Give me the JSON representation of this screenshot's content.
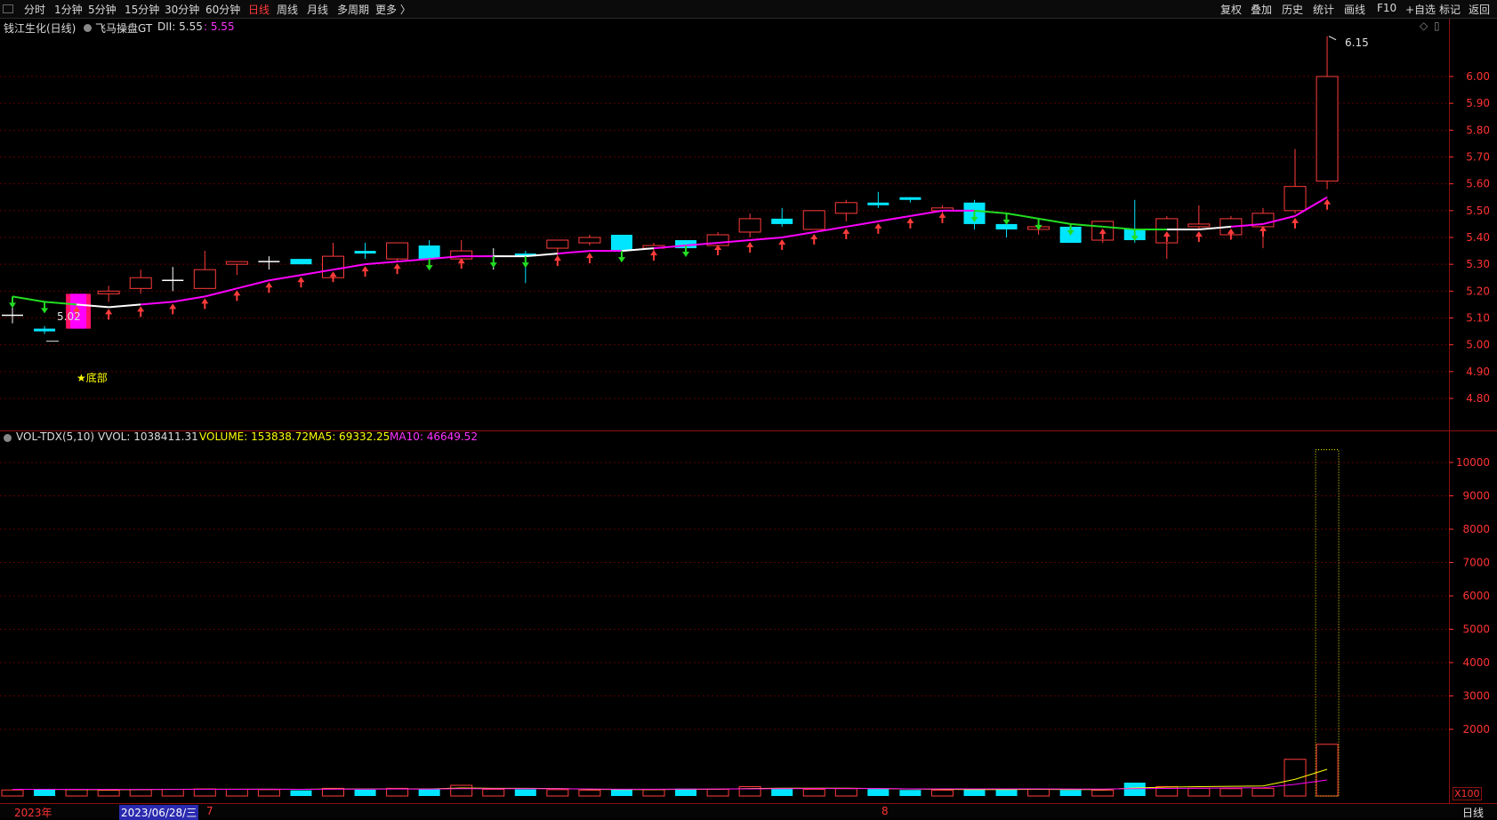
{
  "toolbar": {
    "periods": [
      "分时",
      "1分钟",
      "5分钟",
      "15分钟",
      "30分钟",
      "60分钟",
      "日线",
      "周线",
      "月线",
      "多周期",
      "更多 〉"
    ],
    "active_period": "日线",
    "right_buttons": [
      "复权",
      "叠加",
      "历史",
      "统计",
      "画线",
      "F10",
      "+自选",
      "标记",
      "返回"
    ]
  },
  "main_header": {
    "stock": "钱江生化(日线)",
    "indicator": "飞马操盘GT",
    "dii_label": "DII: 5.55",
    "dii_value": ": 5.55"
  },
  "vol_header": {
    "name": "VOL-TDX(5,10)",
    "vvol": "VVOL: 1038411.31",
    "volume": "VOLUME: 153838.72",
    "ma5": "MA5: 69332.25",
    "ma10": "MA10: 46649.52"
  },
  "annotations": {
    "high": "6.15",
    "low": "5.02",
    "bottom_signal": "★底部",
    "vol_unit": "X100"
  },
  "bottom_bar": {
    "year": "2023年",
    "cursor_date": "2023/06/28/三",
    "month_7": "7",
    "month_8": "8",
    "period_label": "日线"
  },
  "colors": {
    "up": "#ff3b3b",
    "down": "#00e5ff",
    "flat": "#ffffff",
    "ma_green": "#22dd22",
    "ma_magenta": "#ff00ff",
    "axis_text": "#ff3333",
    "grid": "#5a0000",
    "yellow": "#ffff00"
  },
  "chart_data": [
    {
      "type": "candlestick",
      "price_axis": [
        6.0,
        5.9,
        5.8,
        5.7,
        5.6,
        5.5,
        5.4,
        5.3,
        5.2,
        5.1,
        5.0,
        4.9,
        4.8
      ],
      "ylim": [
        4.7,
        6.2
      ],
      "candles": [
        {
          "o": 5.11,
          "h": 5.14,
          "l": 5.08,
          "c": 5.11
        },
        {
          "o": 5.06,
          "h": 5.07,
          "l": 5.04,
          "c": 5.05
        },
        {
          "o": 5.06,
          "h": 5.19,
          "l": 5.06,
          "c": 5.19,
          "special": "magenta"
        },
        {
          "o": 5.19,
          "h": 5.22,
          "l": 5.16,
          "c": 5.2
        },
        {
          "o": 5.21,
          "h": 5.28,
          "l": 5.19,
          "c": 5.25
        },
        {
          "o": 5.24,
          "h": 5.29,
          "l": 5.2,
          "c": 5.24
        },
        {
          "o": 5.21,
          "h": 5.35,
          "l": 5.21,
          "c": 5.28
        },
        {
          "o": 5.3,
          "h": 5.31,
          "l": 5.26,
          "c": 5.31
        },
        {
          "o": 5.31,
          "h": 5.33,
          "l": 5.28,
          "c": 5.31
        },
        {
          "o": 5.32,
          "h": 5.32,
          "l": 5.3,
          "c": 5.3
        },
        {
          "o": 5.25,
          "h": 5.38,
          "l": 5.25,
          "c": 5.33
        },
        {
          "o": 5.35,
          "h": 5.38,
          "l": 5.32,
          "c": 5.34
        },
        {
          "o": 5.32,
          "h": 5.38,
          "l": 5.31,
          "c": 5.38
        },
        {
          "o": 5.37,
          "h": 5.39,
          "l": 5.31,
          "c": 5.32
        },
        {
          "o": 5.32,
          "h": 5.39,
          "l": 5.31,
          "c": 5.35
        },
        {
          "o": 5.33,
          "h": 5.36,
          "l": 5.28,
          "c": 5.33
        },
        {
          "o": 5.34,
          "h": 5.35,
          "l": 5.23,
          "c": 5.33
        },
        {
          "o": 5.36,
          "h": 5.39,
          "l": 5.33,
          "c": 5.39
        },
        {
          "o": 5.38,
          "h": 5.41,
          "l": 5.37,
          "c": 5.4
        },
        {
          "o": 5.41,
          "h": 5.41,
          "l": 5.35,
          "c": 5.35
        },
        {
          "o": 5.36,
          "h": 5.38,
          "l": 5.35,
          "c": 5.37
        },
        {
          "o": 5.39,
          "h": 5.39,
          "l": 5.35,
          "c": 5.36
        },
        {
          "o": 5.37,
          "h": 5.42,
          "l": 5.36,
          "c": 5.41
        },
        {
          "o": 5.42,
          "h": 5.49,
          "l": 5.4,
          "c": 5.47
        },
        {
          "o": 5.47,
          "h": 5.51,
          "l": 5.44,
          "c": 5.45
        },
        {
          "o": 5.43,
          "h": 5.5,
          "l": 5.43,
          "c": 5.5
        },
        {
          "o": 5.49,
          "h": 5.54,
          "l": 5.46,
          "c": 5.53
        },
        {
          "o": 5.53,
          "h": 5.57,
          "l": 5.51,
          "c": 5.52
        },
        {
          "o": 5.55,
          "h": 5.55,
          "l": 5.53,
          "c": 5.54
        },
        {
          "o": 5.5,
          "h": 5.52,
          "l": 5.48,
          "c": 5.51
        },
        {
          "o": 5.53,
          "h": 5.54,
          "l": 5.43,
          "c": 5.45
        },
        {
          "o": 5.45,
          "h": 5.46,
          "l": 5.4,
          "c": 5.43
        },
        {
          "o": 5.43,
          "h": 5.45,
          "l": 5.41,
          "c": 5.44
        },
        {
          "o": 5.44,
          "h": 5.44,
          "l": 5.38,
          "c": 5.38
        },
        {
          "o": 5.39,
          "h": 5.46,
          "l": 5.38,
          "c": 5.46
        },
        {
          "o": 5.43,
          "h": 5.54,
          "l": 5.38,
          "c": 5.39
        },
        {
          "o": 5.38,
          "h": 5.48,
          "l": 5.32,
          "c": 5.47
        },
        {
          "o": 5.44,
          "h": 5.52,
          "l": 5.43,
          "c": 5.45
        },
        {
          "o": 5.41,
          "h": 5.48,
          "l": 5.39,
          "c": 5.47
        },
        {
          "o": 5.44,
          "h": 5.51,
          "l": 5.36,
          "c": 5.49
        },
        {
          "o": 5.5,
          "h": 5.73,
          "l": 5.49,
          "c": 5.59
        },
        {
          "o": 5.61,
          "h": 6.15,
          "l": 5.58,
          "c": 6.0
        }
      ],
      "ma_line": [
        5.18,
        5.16,
        5.15,
        5.14,
        5.15,
        5.16,
        5.18,
        5.21,
        5.24,
        5.26,
        5.28,
        5.3,
        5.31,
        5.32,
        5.33,
        5.33,
        5.33,
        5.34,
        5.35,
        5.35,
        5.36,
        5.37,
        5.38,
        5.39,
        5.4,
        5.42,
        5.44,
        5.46,
        5.48,
        5.5,
        5.5,
        5.49,
        5.47,
        5.45,
        5.44,
        5.43,
        5.43,
        5.43,
        5.44,
        5.45,
        5.48,
        5.55
      ],
      "ma_color_segments": [
        "green",
        "green",
        "white",
        "white",
        "magenta",
        "magenta",
        "magenta",
        "magenta",
        "magenta",
        "magenta",
        "magenta",
        "magenta",
        "magenta",
        "magenta",
        "magenta",
        "white",
        "white",
        "magenta",
        "magenta",
        "white",
        "magenta",
        "magenta",
        "magenta",
        "magenta",
        "magenta",
        "magenta",
        "magenta",
        "magenta",
        "magenta",
        "magenta",
        "green",
        "green",
        "green",
        "green",
        "green",
        "green",
        "white",
        "white",
        "magenta",
        "magenta",
        "magenta",
        "magenta"
      ],
      "arrows": [
        "down",
        "down",
        "up",
        "up",
        "up",
        "up",
        "up",
        "up",
        "up",
        "up",
        "up",
        "up",
        "up",
        "down",
        "up",
        "down",
        "down",
        "up",
        "up",
        "down",
        "up",
        "down",
        "up",
        "up",
        "up",
        "up",
        "up",
        "up",
        "up",
        "up",
        "down",
        "down",
        "down",
        "down",
        "up",
        "down",
        "up",
        "up",
        "up",
        "up",
        "up",
        "up"
      ]
    },
    {
      "type": "bar",
      "title": "VOL-TDX(5,10)",
      "y_axis": [
        10000,
        9000,
        8000,
        7000,
        6000,
        5000,
        4000,
        3000,
        2000
      ],
      "ylim": [
        0,
        10500
      ],
      "unit": "X100",
      "volumes": [
        180,
        200,
        190,
        170,
        190,
        200,
        210,
        200,
        190,
        170,
        230,
        190,
        230,
        200,
        320,
        200,
        200,
        190,
        170,
        190,
        190,
        220,
        200,
        280,
        230,
        200,
        220,
        210,
        180,
        170,
        210,
        220,
        200,
        180,
        170,
        400,
        280,
        230,
        220,
        230,
        1100,
        1550
      ],
      "vvol_last": 10384,
      "ma5_line": [
        200,
        200,
        195,
        190,
        195,
        200,
        205,
        205,
        205,
        200,
        210,
        210,
        215,
        210,
        240,
        230,
        230,
        225,
        200,
        195,
        195,
        200,
        205,
        225,
        235,
        235,
        235,
        225,
        210,
        200,
        195,
        195,
        200,
        195,
        195,
        240,
        265,
        280,
        290,
        300,
        500,
        800
      ],
      "ma10_line": [
        200,
        200,
        200,
        198,
        198,
        198,
        200,
        200,
        202,
        200,
        205,
        206,
        210,
        208,
        220,
        218,
        220,
        218,
        210,
        205,
        205,
        208,
        210,
        215,
        220,
        222,
        225,
        222,
        215,
        212,
        212,
        212,
        215,
        210,
        208,
        220,
        228,
        235,
        240,
        245,
        350,
        480
      ]
    }
  ]
}
